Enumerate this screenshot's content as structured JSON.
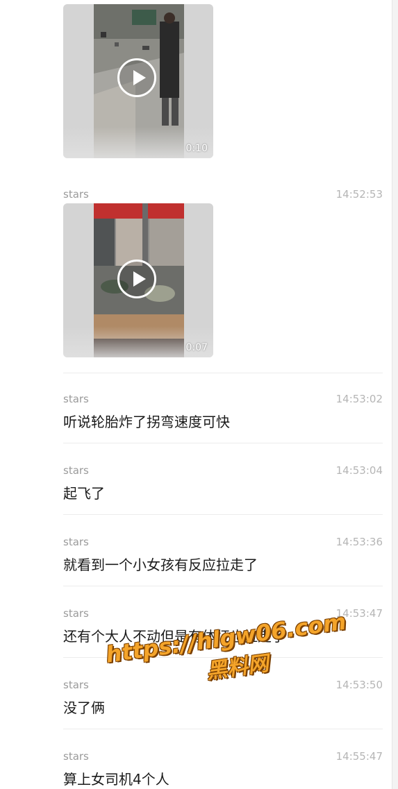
{
  "videos": [
    {
      "duration": "0:10"
    },
    {
      "sender": "stars",
      "time": "14:52:53",
      "duration": "0:07"
    }
  ],
  "messages": [
    {
      "sender": "stars",
      "time": "14:53:02",
      "text": "听说轮胎炸了拐弯速度可快"
    },
    {
      "sender": "stars",
      "time": "14:53:04",
      "text": "起飞了"
    },
    {
      "sender": "stars",
      "time": "14:53:36",
      "text": "就看到一个小女孩有反应拉走了"
    },
    {
      "sender": "stars",
      "time": "14:53:47",
      "text": "还有个大人不动但是有体征也拉走了"
    },
    {
      "sender": "stars",
      "time": "14:53:50",
      "text": "没了俩"
    },
    {
      "sender": "stars",
      "time": "14:55:47",
      "text": "算上女司机4个人"
    }
  ],
  "watermark": {
    "url": "https://hlgw06.com",
    "name": "黑料网"
  },
  "colors": {
    "watermark": "#f4a42a",
    "watermark_outline": "#7a3f00"
  }
}
